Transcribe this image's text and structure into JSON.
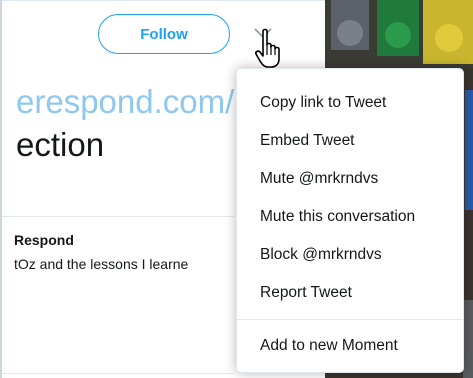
{
  "tweet_header": {
    "follow_label": "Follow"
  },
  "card": {
    "link_fragment": "erespond.com/",
    "heading_fragment": "ection",
    "title": "Respond",
    "description": "tOz and the lessons I learne"
  },
  "menu": {
    "items": [
      {
        "label": "Copy link to Tweet"
      },
      {
        "label": "Embed Tweet"
      },
      {
        "label": "Mute @mrkrndvs"
      },
      {
        "label": "Mute this conversation"
      },
      {
        "label": "Block @mrkrndvs"
      },
      {
        "label": "Report Tweet"
      }
    ],
    "moment_label": "Add to new Moment"
  },
  "icons": {
    "caret": "chevron-down-icon",
    "pointer": "hand-pointer-cursor-icon"
  },
  "colors": {
    "accent": "#1da1f2",
    "link_faded": "#8fc8ee",
    "text": "#14171a"
  }
}
